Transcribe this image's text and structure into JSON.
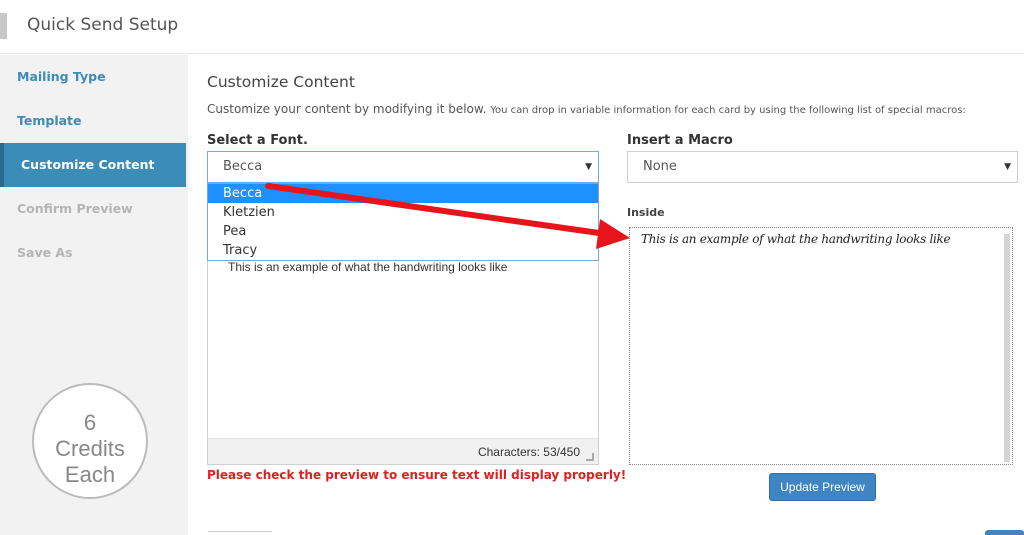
{
  "header": {
    "title": "Quick Send Setup"
  },
  "sidebar": {
    "items": [
      {
        "label": "Mailing Type",
        "state": "link"
      },
      {
        "label": "Template",
        "state": "link"
      },
      {
        "label": "Customize Content",
        "state": "active"
      },
      {
        "label": "Confirm Preview",
        "state": "disabled"
      },
      {
        "label": "Save As",
        "state": "disabled"
      }
    ],
    "credits": {
      "number": "6",
      "line2": "Credits",
      "line3": "Each"
    }
  },
  "main": {
    "title": "Customize Content",
    "description_main": "Customize your content by modifying it below.",
    "description_small": "You can drop in variable information for each card by using the following list of special macros:",
    "font": {
      "label": "Select a Font.",
      "selected": "Becca",
      "options": [
        "Becca",
        "Kletzien",
        "Pea",
        "Tracy"
      ]
    },
    "macro": {
      "label": "Insert a Macro",
      "selected": "None"
    },
    "editor": {
      "text": "This is an example of what the handwriting looks like",
      "counter": "Characters: 53/450"
    },
    "warning": "Please check the preview to ensure text will display properly!",
    "preview": {
      "label": "Inside",
      "text": "This is an example of what the handwriting looks like"
    },
    "update_button": "Update Preview"
  },
  "colors": {
    "accent": "#3c8cb8",
    "button": "#3f85c3",
    "warning": "#e02020",
    "arrow": "#e8141c",
    "dropdown_selected": "#1e90ff"
  }
}
